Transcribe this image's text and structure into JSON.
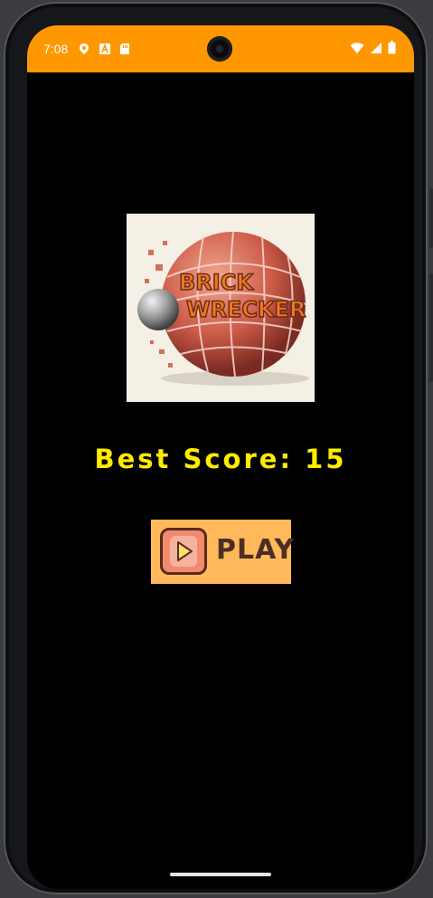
{
  "status_bar": {
    "time": "7:08",
    "color": "#ff9800",
    "left_icons": [
      "location-icon",
      "a-icon",
      "sd-card-icon"
    ],
    "right_icons": [
      "wifi-icon",
      "signal-icon",
      "battery-icon"
    ]
  },
  "app": {
    "logo": {
      "line1": "BRICK",
      "line2": "WRECKER"
    },
    "best_score_label": "Best Score: 15",
    "play_button_label": "PLAY",
    "colors": {
      "background": "#000000",
      "score_text": "#ffeb00",
      "play_button": "#ffb95a"
    }
  }
}
